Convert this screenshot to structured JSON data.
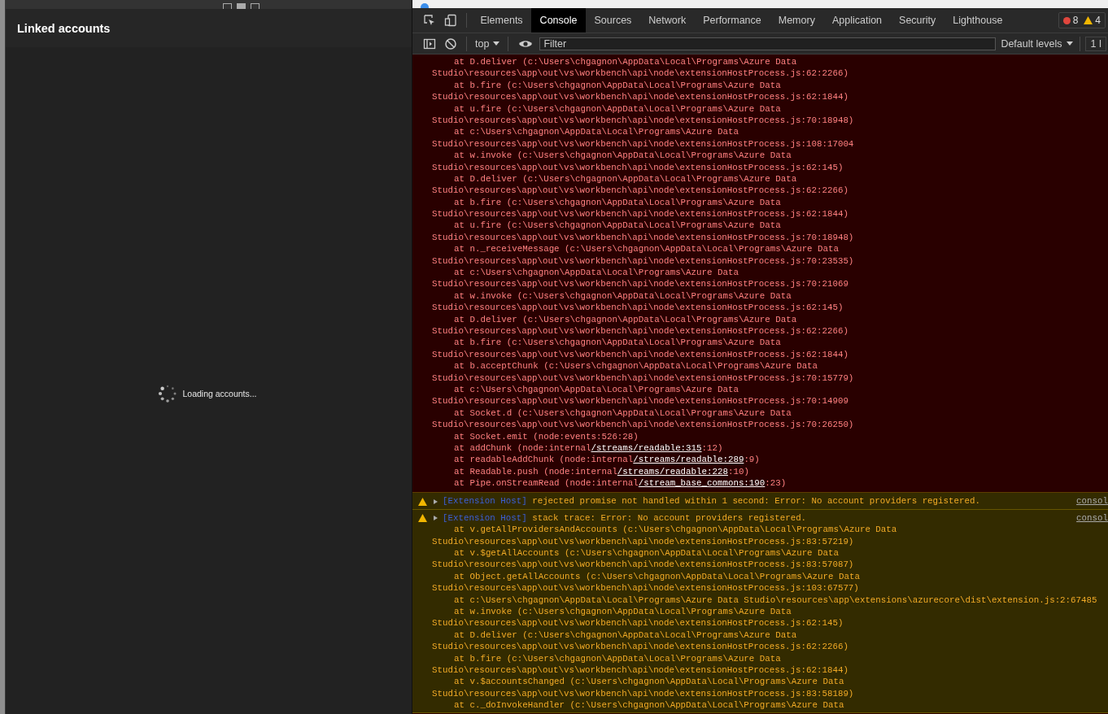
{
  "left_panel": {
    "title": "Linked accounts",
    "loading_text": "Loading accounts..."
  },
  "devtools": {
    "tabs": [
      {
        "label": "Elements",
        "selected": false
      },
      {
        "label": "Console",
        "selected": true
      },
      {
        "label": "Sources",
        "selected": false
      },
      {
        "label": "Network",
        "selected": false
      },
      {
        "label": "Performance",
        "selected": false
      },
      {
        "label": "Memory",
        "selected": false
      },
      {
        "label": "Application",
        "selected": false
      },
      {
        "label": "Security",
        "selected": false
      },
      {
        "label": "Lighthouse",
        "selected": false
      }
    ],
    "error_count": "8",
    "warning_count": "4",
    "toolbar": {
      "context": "top",
      "filter_placeholder": "Filter",
      "levels": "Default levels",
      "issues": "1 I"
    },
    "messages": [
      {
        "kind": "error",
        "lines": [
          {
            "kind": "at",
            "parts": [
              {
                "text": "at D.deliver (c:\\Users\\chgagnon\\AppData\\Local\\Programs\\Azure Data",
                "link": false
              }
            ]
          },
          {
            "kind": "wrap",
            "parts": [
              {
                "text": "Studio\\resources\\app\\out\\vs\\workbench\\api\\node\\extensionHostProcess.js:62:2266)",
                "link": false
              }
            ]
          },
          {
            "kind": "at",
            "parts": [
              {
                "text": "at b.fire (c:\\Users\\chgagnon\\AppData\\Local\\Programs\\Azure Data",
                "link": false
              }
            ]
          },
          {
            "kind": "wrap",
            "parts": [
              {
                "text": "Studio\\resources\\app\\out\\vs\\workbench\\api\\node\\extensionHostProcess.js:62:1844)",
                "link": false
              }
            ]
          },
          {
            "kind": "at",
            "parts": [
              {
                "text": "at u.fire (c:\\Users\\chgagnon\\AppData\\Local\\Programs\\Azure Data",
                "link": false
              }
            ]
          },
          {
            "kind": "wrap",
            "parts": [
              {
                "text": "Studio\\resources\\app\\out\\vs\\workbench\\api\\node\\extensionHostProcess.js:70:18948)",
                "link": false
              }
            ]
          },
          {
            "kind": "at",
            "parts": [
              {
                "text": "at c:\\Users\\chgagnon\\AppData\\Local\\Programs\\Azure Data",
                "link": false
              }
            ]
          },
          {
            "kind": "wrap",
            "parts": [
              {
                "text": "Studio\\resources\\app\\out\\vs\\workbench\\api\\node\\extensionHostProcess.js:108:17004",
                "link": false
              }
            ]
          },
          {
            "kind": "at",
            "parts": [
              {
                "text": "at w.invoke (c:\\Users\\chgagnon\\AppData\\Local\\Programs\\Azure Data",
                "link": false
              }
            ]
          },
          {
            "kind": "wrap",
            "parts": [
              {
                "text": "Studio\\resources\\app\\out\\vs\\workbench\\api\\node\\extensionHostProcess.js:62:145)",
                "link": false
              }
            ]
          },
          {
            "kind": "at",
            "parts": [
              {
                "text": "at D.deliver (c:\\Users\\chgagnon\\AppData\\Local\\Programs\\Azure Data",
                "link": false
              }
            ]
          },
          {
            "kind": "wrap",
            "parts": [
              {
                "text": "Studio\\resources\\app\\out\\vs\\workbench\\api\\node\\extensionHostProcess.js:62:2266)",
                "link": false
              }
            ]
          },
          {
            "kind": "at",
            "parts": [
              {
                "text": "at b.fire (c:\\Users\\chgagnon\\AppData\\Local\\Programs\\Azure Data",
                "link": false
              }
            ]
          },
          {
            "kind": "wrap",
            "parts": [
              {
                "text": "Studio\\resources\\app\\out\\vs\\workbench\\api\\node\\extensionHostProcess.js:62:1844)",
                "link": false
              }
            ]
          },
          {
            "kind": "at",
            "parts": [
              {
                "text": "at u.fire (c:\\Users\\chgagnon\\AppData\\Local\\Programs\\Azure Data",
                "link": false
              }
            ]
          },
          {
            "kind": "wrap",
            "parts": [
              {
                "text": "Studio\\resources\\app\\out\\vs\\workbench\\api\\node\\extensionHostProcess.js:70:18948)",
                "link": false
              }
            ]
          },
          {
            "kind": "at",
            "parts": [
              {
                "text": "at n._receiveMessage (c:\\Users\\chgagnon\\AppData\\Local\\Programs\\Azure Data",
                "link": false
              }
            ]
          },
          {
            "kind": "wrap",
            "parts": [
              {
                "text": "Studio\\resources\\app\\out\\vs\\workbench\\api\\node\\extensionHostProcess.js:70:23535)",
                "link": false
              }
            ]
          },
          {
            "kind": "at",
            "parts": [
              {
                "text": "at c:\\Users\\chgagnon\\AppData\\Local\\Programs\\Azure Data",
                "link": false
              }
            ]
          },
          {
            "kind": "wrap",
            "parts": [
              {
                "text": "Studio\\resources\\app\\out\\vs\\workbench\\api\\node\\extensionHostProcess.js:70:21069",
                "link": false
              }
            ]
          },
          {
            "kind": "at",
            "parts": [
              {
                "text": "at w.invoke (c:\\Users\\chgagnon\\AppData\\Local\\Programs\\Azure Data",
                "link": false
              }
            ]
          },
          {
            "kind": "wrap",
            "parts": [
              {
                "text": "Studio\\resources\\app\\out\\vs\\workbench\\api\\node\\extensionHostProcess.js:62:145)",
                "link": false
              }
            ]
          },
          {
            "kind": "at",
            "parts": [
              {
                "text": "at D.deliver (c:\\Users\\chgagnon\\AppData\\Local\\Programs\\Azure Data",
                "link": false
              }
            ]
          },
          {
            "kind": "wrap",
            "parts": [
              {
                "text": "Studio\\resources\\app\\out\\vs\\workbench\\api\\node\\extensionHostProcess.js:62:2266)",
                "link": false
              }
            ]
          },
          {
            "kind": "at",
            "parts": [
              {
                "text": "at b.fire (c:\\Users\\chgagnon\\AppData\\Local\\Programs\\Azure Data",
                "link": false
              }
            ]
          },
          {
            "kind": "wrap",
            "parts": [
              {
                "text": "Studio\\resources\\app\\out\\vs\\workbench\\api\\node\\extensionHostProcess.js:62:1844)",
                "link": false
              }
            ]
          },
          {
            "kind": "at",
            "parts": [
              {
                "text": "at b.acceptChunk (c:\\Users\\chgagnon\\AppData\\Local\\Programs\\Azure Data",
                "link": false
              }
            ]
          },
          {
            "kind": "wrap",
            "parts": [
              {
                "text": "Studio\\resources\\app\\out\\vs\\workbench\\api\\node\\extensionHostProcess.js:70:15779)",
                "link": false
              }
            ]
          },
          {
            "kind": "at",
            "parts": [
              {
                "text": "at c:\\Users\\chgagnon\\AppData\\Local\\Programs\\Azure Data",
                "link": false
              }
            ]
          },
          {
            "kind": "wrap",
            "parts": [
              {
                "text": "Studio\\resources\\app\\out\\vs\\workbench\\api\\node\\extensionHostProcess.js:70:14909",
                "link": false
              }
            ]
          },
          {
            "kind": "at",
            "parts": [
              {
                "text": "at Socket.d (c:\\Users\\chgagnon\\AppData\\Local\\Programs\\Azure Data",
                "link": false
              }
            ]
          },
          {
            "kind": "wrap",
            "parts": [
              {
                "text": "Studio\\resources\\app\\out\\vs\\workbench\\api\\node\\extensionHostProcess.js:70:26250)",
                "link": false
              }
            ]
          },
          {
            "kind": "at",
            "parts": [
              {
                "text": "at Socket.emit (node:events:526:28)",
                "link": false
              }
            ]
          },
          {
            "kind": "at",
            "parts": [
              {
                "text": "at addChunk (node:internal",
                "link": false
              },
              {
                "text": "/streams/readable:315",
                "link": true
              },
              {
                "text": ":12)",
                "link": false
              }
            ]
          },
          {
            "kind": "at",
            "parts": [
              {
                "text": "at readableAddChunk (node:internal",
                "link": false
              },
              {
                "text": "/streams/readable:289",
                "link": true
              },
              {
                "text": ":9)",
                "link": false
              }
            ]
          },
          {
            "kind": "at",
            "parts": [
              {
                "text": "at Readable.push (node:internal",
                "link": false
              },
              {
                "text": "/streams/readable:228",
                "link": true
              },
              {
                "text": ":10)",
                "link": false
              }
            ]
          },
          {
            "kind": "at",
            "parts": [
              {
                "text": "at Pipe.onStreamRead (node:internal",
                "link": false
              },
              {
                "text": "/stream_base_commons:190",
                "link": true
              },
              {
                "text": ":23)",
                "link": false
              }
            ]
          }
        ]
      },
      {
        "kind": "warning",
        "source": "[Extension Host]",
        "message": "rejected promise not handled within 1 second: Error: No account providers registered.",
        "location": "consol"
      },
      {
        "kind": "warning",
        "source": "[Extension Host]",
        "message": "stack trace: Error: No account providers registered.",
        "location": "consol",
        "lines": [
          {
            "kind": "at",
            "parts": [
              {
                "text": "at v.getAllProvidersAndAccounts (c:\\Users\\chgagnon\\AppData\\Local\\Programs\\Azure Data",
                "link": false
              }
            ]
          },
          {
            "kind": "wrap",
            "parts": [
              {
                "text": "Studio\\resources\\app\\out\\vs\\workbench\\api\\node\\extensionHostProcess.js:83:57219)",
                "link": false
              }
            ]
          },
          {
            "kind": "at",
            "parts": [
              {
                "text": "at v.$getAllAccounts (c:\\Users\\chgagnon\\AppData\\Local\\Programs\\Azure Data",
                "link": false
              }
            ]
          },
          {
            "kind": "wrap",
            "parts": [
              {
                "text": "Studio\\resources\\app\\out\\vs\\workbench\\api\\node\\extensionHostProcess.js:83:57087)",
                "link": false
              }
            ]
          },
          {
            "kind": "at",
            "parts": [
              {
                "text": "at Object.getAllAccounts (c:\\Users\\chgagnon\\AppData\\Local\\Programs\\Azure Data",
                "link": false
              }
            ]
          },
          {
            "kind": "wrap",
            "parts": [
              {
                "text": "Studio\\resources\\app\\out\\vs\\workbench\\api\\node\\extensionHostProcess.js:103:67577)",
                "link": false
              }
            ]
          },
          {
            "kind": "at",
            "parts": [
              {
                "text": "at c:\\Users\\chgagnon\\AppData\\Local\\Programs\\Azure Data Studio\\resources\\app\\extensions\\azurecore\\dist\\extension.js:2:67485",
                "link": false
              }
            ]
          },
          {
            "kind": "at",
            "parts": [
              {
                "text": "at w.invoke (c:\\Users\\chgagnon\\AppData\\Local\\Programs\\Azure Data",
                "link": false
              }
            ]
          },
          {
            "kind": "wrap",
            "parts": [
              {
                "text": "Studio\\resources\\app\\out\\vs\\workbench\\api\\node\\extensionHostProcess.js:62:145)",
                "link": false
              }
            ]
          },
          {
            "kind": "at",
            "parts": [
              {
                "text": "at D.deliver (c:\\Users\\chgagnon\\AppData\\Local\\Programs\\Azure Data",
                "link": false
              }
            ]
          },
          {
            "kind": "wrap",
            "parts": [
              {
                "text": "Studio\\resources\\app\\out\\vs\\workbench\\api\\node\\extensionHostProcess.js:62:2266)",
                "link": false
              }
            ]
          },
          {
            "kind": "at",
            "parts": [
              {
                "text": "at b.fire (c:\\Users\\chgagnon\\AppData\\Local\\Programs\\Azure Data",
                "link": false
              }
            ]
          },
          {
            "kind": "wrap",
            "parts": [
              {
                "text": "Studio\\resources\\app\\out\\vs\\workbench\\api\\node\\extensionHostProcess.js:62:1844)",
                "link": false
              }
            ]
          },
          {
            "kind": "at",
            "parts": [
              {
                "text": "at v.$accountsChanged (c:\\Users\\chgagnon\\AppData\\Local\\Programs\\Azure Data",
                "link": false
              }
            ]
          },
          {
            "kind": "wrap",
            "parts": [
              {
                "text": "Studio\\resources\\app\\out\\vs\\workbench\\api\\node\\extensionHostProcess.js:83:58189)",
                "link": false
              }
            ]
          },
          {
            "kind": "at",
            "parts": [
              {
                "text": "at c._doInvokeHandler (c:\\Users\\chgagnon\\AppData\\Local\\Programs\\Azure Data",
                "link": false
              }
            ]
          }
        ]
      }
    ]
  }
}
